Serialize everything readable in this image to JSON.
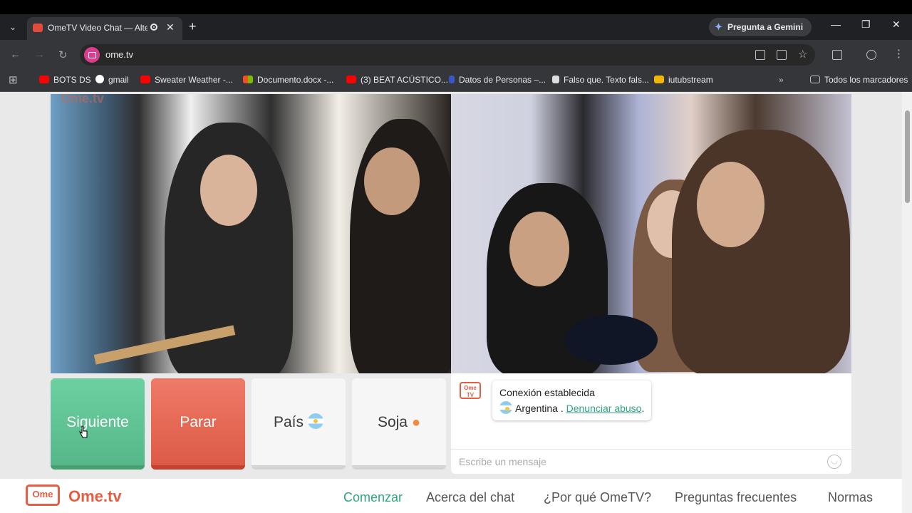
{
  "browser": {
    "tab_title": "OmeTV Video Chat — Alter",
    "gemini_label": "Pregunta a Gemini",
    "url": "ome.tv",
    "bookmarks": [
      {
        "label": "BOTS DS",
        "color": "#ff0000"
      },
      {
        "label": "gmail",
        "color": "#ffffff"
      },
      {
        "label": "Sweater Weather -...",
        "color": "#ff0000"
      },
      {
        "label": "Documento.docx -...",
        "color": "#f2b705"
      },
      {
        "label": "(3) BEAT ACÚSTICO...",
        "color": "#ff0000"
      },
      {
        "label": "Datos de Personas –...",
        "color": "#3a56c5"
      },
      {
        "label": "Falso que. Texto fals...",
        "color": "#dddddd"
      },
      {
        "label": "iutubstream",
        "color": "#f2b705"
      }
    ],
    "all_bookmarks": "Todos los marcadores"
  },
  "video": {
    "watermark": "Ome.tv"
  },
  "controls": {
    "next_label": "Siguiente",
    "stop_label": "Parar",
    "country_label": "País",
    "gender_label": "Soja"
  },
  "chat": {
    "logo": "Ome TV",
    "status": "Conexión establecida",
    "country": "Argentina",
    "separator": " . ",
    "report_link": "Denunciar abuso",
    "period": ".",
    "input_placeholder": "Escribe un mensaje"
  },
  "footer": {
    "logo_text": "Ome",
    "brand": "Ome.tv",
    "nav": [
      "Comenzar",
      "Acerca del chat",
      "¿Por qué OmeTV?",
      "Preguntas frecuentes",
      "Normas"
    ]
  },
  "colors": {
    "next": "#5fc495",
    "stop": "#e6664f",
    "accent": "#2ea57a",
    "brand": "#e55d43"
  }
}
